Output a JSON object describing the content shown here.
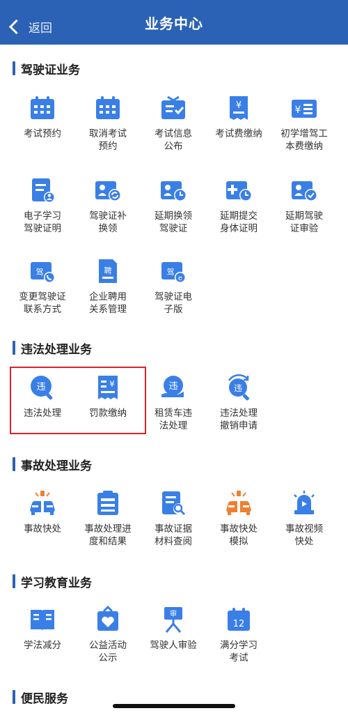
{
  "header": {
    "back_label": "返回",
    "title": "业务中心"
  },
  "sections": [
    {
      "title": "驾驶证业务",
      "items": [
        {
          "label": "考试预约",
          "icon": "calendar-icon"
        },
        {
          "label": "取消考试\n预约",
          "icon": "calendar-icon"
        },
        {
          "label": "考试信息\n公布",
          "icon": "announcement-icon"
        },
        {
          "label": "考试费缴纳",
          "icon": "fee-receipt-icon"
        },
        {
          "label": "初学增驾工\n本费缴纳",
          "icon": "yen-card-icon"
        },
        {
          "label": "电子学习\n驾驶证明",
          "icon": "document-user-icon"
        },
        {
          "label": "驾驶证补\n换领",
          "icon": "license-refresh-icon"
        },
        {
          "label": "延期换领\n驾驶证",
          "icon": "license-clock-icon"
        },
        {
          "label": "延期提交\n身体证明",
          "icon": "medical-clock-icon"
        },
        {
          "label": "延期驾驶\n证审验",
          "icon": "license-check-icon"
        },
        {
          "label": "变更驾驶证\n联系方式",
          "icon": "license-phone-icon"
        },
        {
          "label": "企业聘用\n关系管理",
          "icon": "hire-document-icon"
        },
        {
          "label": "驾驶证电\n子版",
          "icon": "e-license-icon"
        }
      ]
    },
    {
      "title": "违法处理业务",
      "items": [
        {
          "label": "违法处理",
          "icon": "violation-search-icon"
        },
        {
          "label": "罚款缴纳",
          "icon": "fine-receipt-icon"
        },
        {
          "label": "租赁车违\n法处理",
          "icon": "rental-violation-icon"
        },
        {
          "label": "违法处理\n撤销申请",
          "icon": "violation-revoke-icon"
        }
      ]
    },
    {
      "title": "事故处理业务",
      "items": [
        {
          "label": "事故快处",
          "icon": "accident-cars-icon"
        },
        {
          "label": "事故处理进\n度和结果",
          "icon": "progress-list-icon"
        },
        {
          "label": "事故证据\n材料查阅",
          "icon": "evidence-search-icon"
        },
        {
          "label": "事故快处\n模拟",
          "icon": "accident-sim-icon"
        },
        {
          "label": "事故视频\n快处",
          "icon": "alarm-video-icon"
        }
      ]
    },
    {
      "title": "学习教育业务",
      "items": [
        {
          "label": "学法减分",
          "icon": "book-icon"
        },
        {
          "label": "公益活动\n公示",
          "icon": "charity-heart-icon"
        },
        {
          "label": "驾驶人审验",
          "icon": "review-person-icon"
        },
        {
          "label": "满分学习\n考试",
          "icon": "calendar-12-icon"
        }
      ]
    },
    {
      "title": "便民服务",
      "items": []
    }
  ],
  "colors": {
    "header": "#2b62b5",
    "icon": "#3a7fe6",
    "orange": "#f07f32",
    "highlight": "#d8232a"
  }
}
